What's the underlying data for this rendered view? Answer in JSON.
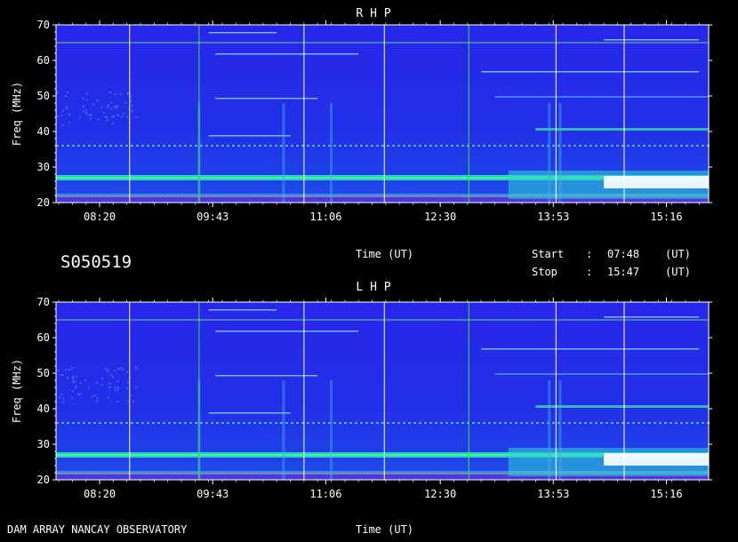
{
  "header": {
    "rhp_title": "R H P",
    "lhp_title": "L H P",
    "session_id": "S050519",
    "footer_left": "DAM ARRAY  NANCAY OBSERVATORY",
    "time_label": "Time (UT)",
    "start_label": "Start",
    "stop_label": "Stop",
    "separator": ":",
    "start_value": "07:48",
    "stop_value": "15:47",
    "unit": "(UT)"
  },
  "chart_data": [
    {
      "type": "heatmap",
      "title": "R H P",
      "xlabel": "Time (UT)",
      "ylabel": "Freq (MHz)",
      "x_range": [
        "07:48",
        "15:47"
      ],
      "ylim": [
        20,
        70
      ],
      "x_ticks": [
        "08:20",
        "09:43",
        "11:06",
        "12:30",
        "13:53",
        "15:16"
      ],
      "y_ticks": [
        20,
        30,
        40,
        50,
        60,
        70
      ],
      "vertical_markers": [
        "08:42",
        "09:33",
        "10:50",
        "11:49",
        "12:51",
        "13:55",
        "14:45"
      ],
      "horizontal_marker_freq": 65,
      "emission_bands_mhz": [
        27,
        22,
        36
      ]
    },
    {
      "type": "heatmap",
      "title": "L H P",
      "xlabel": "Time (UT)",
      "ylabel": "Freq (MHz)",
      "x_range": [
        "07:48",
        "15:47"
      ],
      "ylim": [
        20,
        70
      ],
      "x_ticks": [
        "08:20",
        "09:43",
        "11:06",
        "12:30",
        "13:53",
        "15:16"
      ],
      "y_ticks": [
        20,
        30,
        40,
        50,
        60,
        70
      ],
      "vertical_markers": [
        "08:42",
        "09:33",
        "10:50",
        "11:49",
        "12:51",
        "13:55",
        "14:45"
      ],
      "horizontal_marker_freq": 65,
      "emission_bands_mhz": [
        27,
        22,
        36
      ]
    }
  ],
  "colors": {
    "background": "#000000",
    "spectrum_base": "#2a2ae6",
    "band_cyan": "#30e0e0",
    "band_green": "#40ff60",
    "marker": "#ffffff",
    "marker_green": "#40e040"
  }
}
